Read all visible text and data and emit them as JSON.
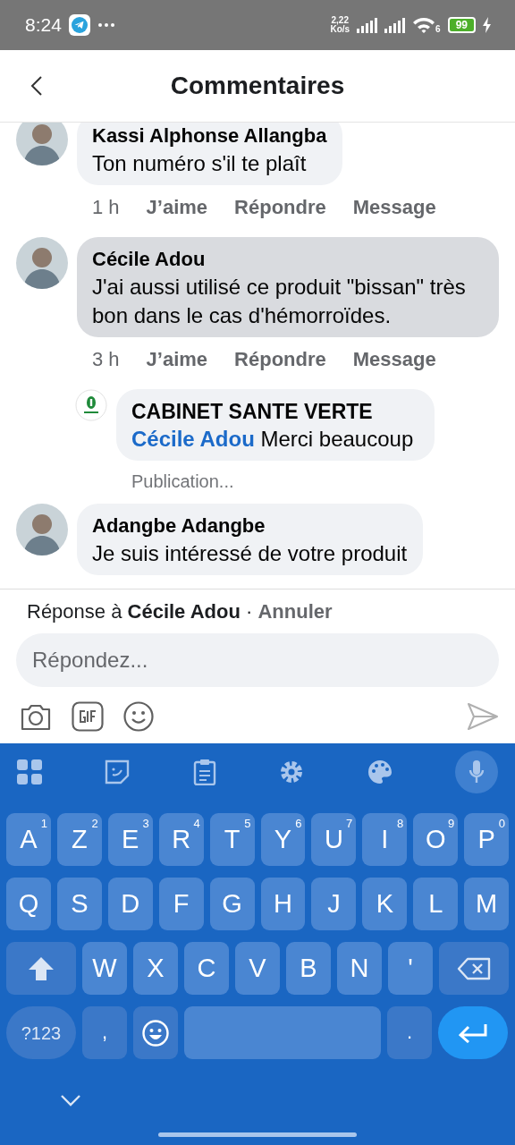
{
  "status_bar": {
    "time": "8:24",
    "speed_value": "2,22",
    "speed_unit": "Ko/s",
    "wifi_label": "6",
    "battery": "99"
  },
  "header": {
    "title": "Commentaires"
  },
  "comments": [
    {
      "author": "Kassi Alphonse Allangba",
      "text": "Ton numéro s'il te plaît",
      "time": "1 h",
      "actions": [
        "J’aime",
        "Répondre",
        "Message"
      ],
      "highlighted": false
    },
    {
      "author": "Cécile Adou",
      "text": "J'ai aussi utilisé ce produit \"bissan\" très bon dans le cas d'hémorroïdes.",
      "time": "3 h",
      "actions": [
        "J’aime",
        "Répondre",
        "Message"
      ],
      "highlighted": true,
      "replies": [
        {
          "author": "CABINET SANTE VERTE",
          "mention": "Cécile Adou",
          "text": "Merci beaucoup",
          "status": "Publication..."
        }
      ]
    },
    {
      "author": "Adangbe Adangbe",
      "text": "Je suis intéressé de votre produit",
      "highlighted": false
    }
  ],
  "reply_bar": {
    "prefix": "Réponse à",
    "name": "Cécile Adou",
    "separator": "·",
    "cancel": "Annuler",
    "placeholder": "Répondez..."
  },
  "keyboard": {
    "rows": [
      [
        {
          "kind": "letter",
          "label": "A",
          "hint": "1"
        },
        {
          "kind": "letter",
          "label": "Z",
          "hint": "2"
        },
        {
          "kind": "letter",
          "label": "E",
          "hint": "3"
        },
        {
          "kind": "letter",
          "label": "R",
          "hint": "4"
        },
        {
          "kind": "letter",
          "label": "T",
          "hint": "5"
        },
        {
          "kind": "letter",
          "label": "Y",
          "hint": "6"
        },
        {
          "kind": "letter",
          "label": "U",
          "hint": "7"
        },
        {
          "kind": "letter",
          "label": "I",
          "hint": "8"
        },
        {
          "kind": "letter",
          "label": "O",
          "hint": "9"
        },
        {
          "kind": "letter",
          "label": "P",
          "hint": "0"
        }
      ],
      [
        {
          "kind": "letter",
          "label": "Q"
        },
        {
          "kind": "letter",
          "label": "S"
        },
        {
          "kind": "letter",
          "label": "D"
        },
        {
          "kind": "letter",
          "label": "F"
        },
        {
          "kind": "letter",
          "label": "G"
        },
        {
          "kind": "letter",
          "label": "H"
        },
        {
          "kind": "letter",
          "label": "J"
        },
        {
          "kind": "letter",
          "label": "K"
        },
        {
          "kind": "letter",
          "label": "L"
        },
        {
          "kind": "letter",
          "label": "M"
        }
      ],
      [
        {
          "kind": "shift"
        },
        {
          "kind": "letter",
          "label": "W"
        },
        {
          "kind": "letter",
          "label": "X"
        },
        {
          "kind": "letter",
          "label": "C"
        },
        {
          "kind": "letter",
          "label": "V"
        },
        {
          "kind": "letter",
          "label": "B"
        },
        {
          "kind": "letter",
          "label": "N"
        },
        {
          "kind": "letter",
          "label": "'"
        },
        {
          "kind": "backspace"
        }
      ],
      [
        {
          "kind": "symbols",
          "label": "?123"
        },
        {
          "kind": "punct",
          "label": ","
        },
        {
          "kind": "emoji"
        },
        {
          "kind": "space"
        },
        {
          "kind": "punct",
          "label": "."
        },
        {
          "kind": "enter"
        }
      ]
    ]
  }
}
